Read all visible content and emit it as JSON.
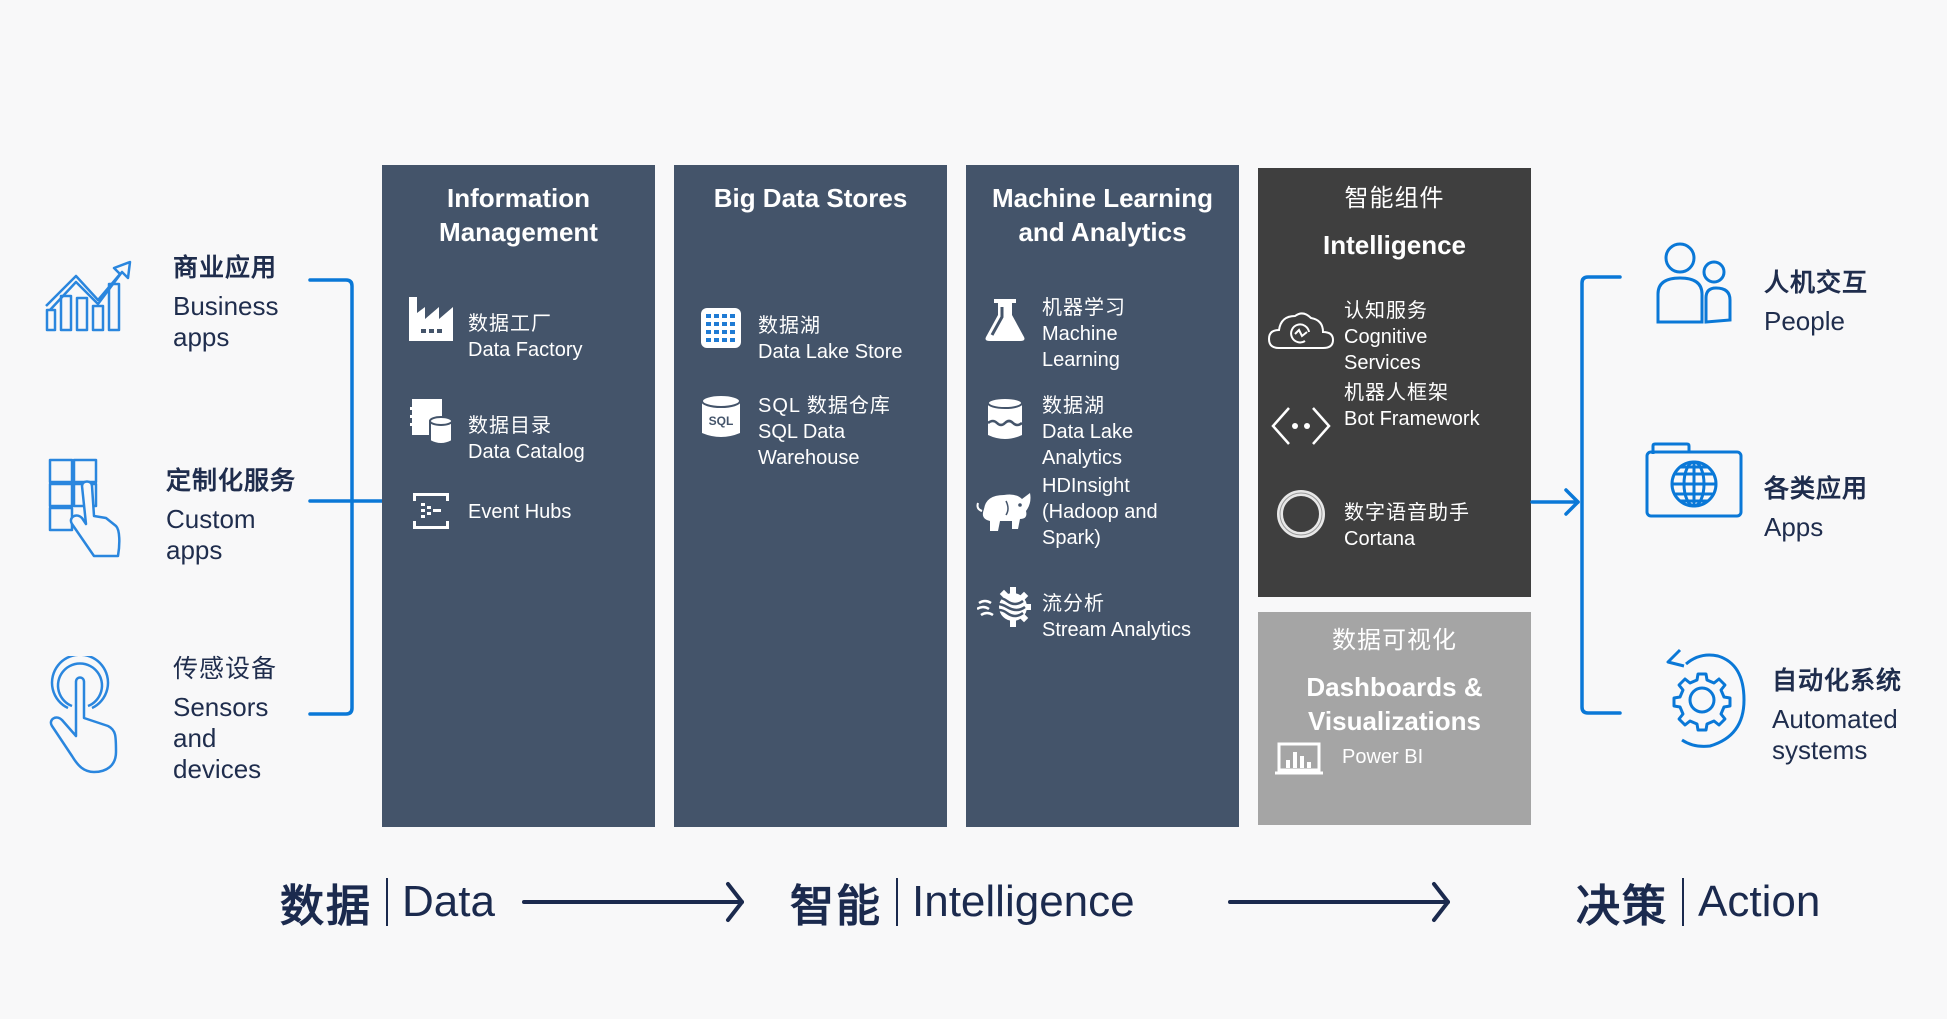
{
  "colors": {
    "background": "#f8f8f9",
    "accent_blue": "#0a78d7",
    "panel_blue": "#44546a",
    "panel_dark": "#3f3f3f",
    "panel_gray": "#a5a5a5",
    "text_navy": "#1b2a4e"
  },
  "sources": [
    {
      "icon": "chart-growth-icon",
      "zh": "商业应用",
      "en": "Business apps"
    },
    {
      "icon": "touch-grid-icon",
      "zh": "定制化服务",
      "en": "Custom apps"
    },
    {
      "icon": "touch-button-icon",
      "zh": "传感设备",
      "en": "Sensors and devices"
    }
  ],
  "panels": {
    "information_management": {
      "title": "Information Management",
      "items": [
        {
          "icon": "factory-icon",
          "zh": "数据工厂",
          "en": "Data Factory"
        },
        {
          "icon": "catalog-icon",
          "zh": "数据目录",
          "en": "Data Catalog"
        },
        {
          "icon": "event-hubs-icon",
          "zh": "",
          "en": "Event Hubs"
        }
      ]
    },
    "big_data_stores": {
      "title": "Big Data Stores",
      "items": [
        {
          "icon": "data-lake-grid-icon",
          "zh": "数据湖",
          "en": "Data Lake Store"
        },
        {
          "icon": "sql-database-icon",
          "zh": "SQL 数据仓库",
          "en": "SQL Data Warehouse"
        }
      ]
    },
    "ml_analytics": {
      "title": "Machine Learning and Analytics",
      "items": [
        {
          "icon": "flask-icon",
          "zh": "机器学习",
          "en": "Machine Learning"
        },
        {
          "icon": "lake-database-icon",
          "zh": "数据湖",
          "en": "Data Lake Analytics"
        },
        {
          "icon": "elephant-icon",
          "zh": "",
          "en": "HDInsight (Hadoop and Spark)"
        },
        {
          "icon": "stream-gear-icon",
          "zh": "流分析",
          "en": "Stream Analytics"
        }
      ]
    },
    "intelligence": {
      "title_zh": "智能组件",
      "title": "Intelligence",
      "items": [
        {
          "icon": "cloud-brain-icon",
          "zh": "认知服务",
          "en": "Cognitive Services"
        },
        {
          "icon": "bot-icon",
          "zh": "机器人框架",
          "en": "Bot Framework"
        },
        {
          "icon": "cortana-ring-icon",
          "zh": "数字语音助手",
          "en": "Cortana"
        }
      ]
    },
    "dashboards": {
      "title_zh": "数据可视化",
      "title": "Dashboards & Visualizations",
      "items": [
        {
          "icon": "power-bi-icon",
          "zh": "",
          "en": "Power BI"
        }
      ]
    }
  },
  "targets": [
    {
      "icon": "people-icon",
      "zh": "人机交互",
      "en": "People"
    },
    {
      "icon": "globe-folder-icon",
      "zh": "各类应用",
      "en": "Apps"
    },
    {
      "icon": "gear-cycle-icon",
      "zh": "自动化系统",
      "en": "Automated systems"
    }
  ],
  "footer": [
    {
      "zh": "数据",
      "en": "Data"
    },
    {
      "zh": "智能",
      "en": "Intelligence"
    },
    {
      "zh": "决策",
      "en": "Action"
    }
  ]
}
